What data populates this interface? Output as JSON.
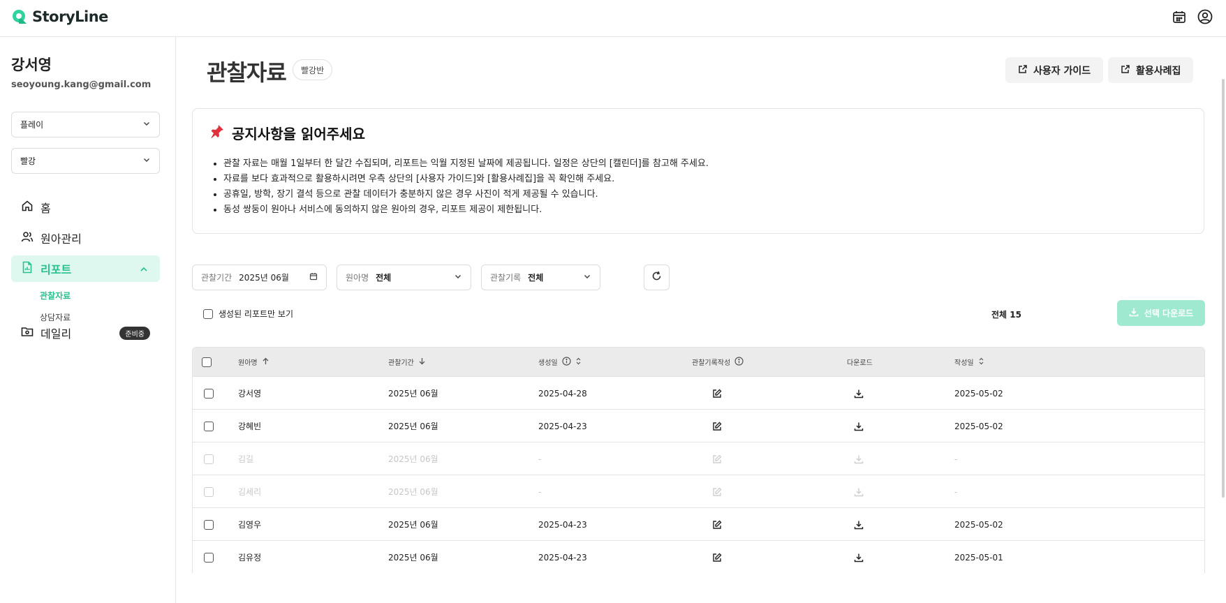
{
  "app": {
    "name": "StoryLine",
    "brand_color": "#28c08e"
  },
  "top_icons": [
    "calendar-icon",
    "account-icon"
  ],
  "sidebar": {
    "user_name": "강서영",
    "user_email": "seoyoung.kang@gmail.com",
    "select_org": "플레이",
    "select_class": "빨강",
    "nav": [
      {
        "label": "홈",
        "icon": "home-icon"
      },
      {
        "label": "원아관리",
        "icon": "users-icon"
      },
      {
        "label": "리포트",
        "icon": "report-icon"
      },
      {
        "label": "데일리",
        "icon": "folder-icon",
        "badge": "준비중"
      }
    ],
    "sub_nav": [
      "관찰자료",
      "상담자료"
    ]
  },
  "main": {
    "title": "관찰자료",
    "class_badge": "빨강반",
    "guide_button": "사용자 가이드",
    "cases_button": "활용사례집",
    "notice": {
      "title": "공지사항을 읽어주세요",
      "items": [
        "관찰 자료는 매월 1일부터 한 달간 수집되며, 리포트는 익월 지정된 날짜에 제공됩니다. 일정은 상단의 [캘린더]를 참고해 주세요.",
        "자료를 보다 효과적으로 활용하시려면 우측 상단의 [사용자 가이드]와 [활용사례집]을 꼭 확인해 주세요.",
        "공휴일, 방학, 장기 결석 등으로 관찰 데이터가 충분하지 않은 경우 사진이 적게 제공될 수 있습니다.",
        "동성 쌍둥이 원아나 서비스에 동의하지 않은 원아의 경우, 리포트 제공이 제한됩니다."
      ]
    },
    "filters": {
      "period_label": "관찰기간",
      "period_value": "2025년 06월",
      "child_label": "원아명",
      "child_value": "전체",
      "record_label": "관찰기록",
      "record_value": "전체"
    },
    "only_generated_label": "생성된 리포트만 보기",
    "total_label": "전체 15",
    "download_selected": "선택 다운로드",
    "table": {
      "headers": [
        "원아명",
        "관찰기간",
        "생성일",
        "관찰기록작성",
        "다운로드",
        "작성일"
      ],
      "rows": [
        {
          "name": "강서영",
          "period": "2025년 06월",
          "created": "2025-04-28",
          "written": "2025-05-02",
          "disabled": false
        },
        {
          "name": "강혜빈",
          "period": "2025년 06월",
          "created": "2025-04-23",
          "written": "2025-05-02",
          "disabled": false
        },
        {
          "name": "김길",
          "period": "2025년 06월",
          "created": "-",
          "written": "-",
          "disabled": true
        },
        {
          "name": "김세리",
          "period": "2025년 06월",
          "created": "-",
          "written": "-",
          "disabled": true
        },
        {
          "name": "김영우",
          "period": "2025년 06월",
          "created": "2025-04-23",
          "written": "2025-05-02",
          "disabled": false
        },
        {
          "name": "김유정",
          "period": "2025년 06월",
          "created": "2025-04-23",
          "written": "2025-05-01",
          "disabled": false
        }
      ]
    }
  }
}
